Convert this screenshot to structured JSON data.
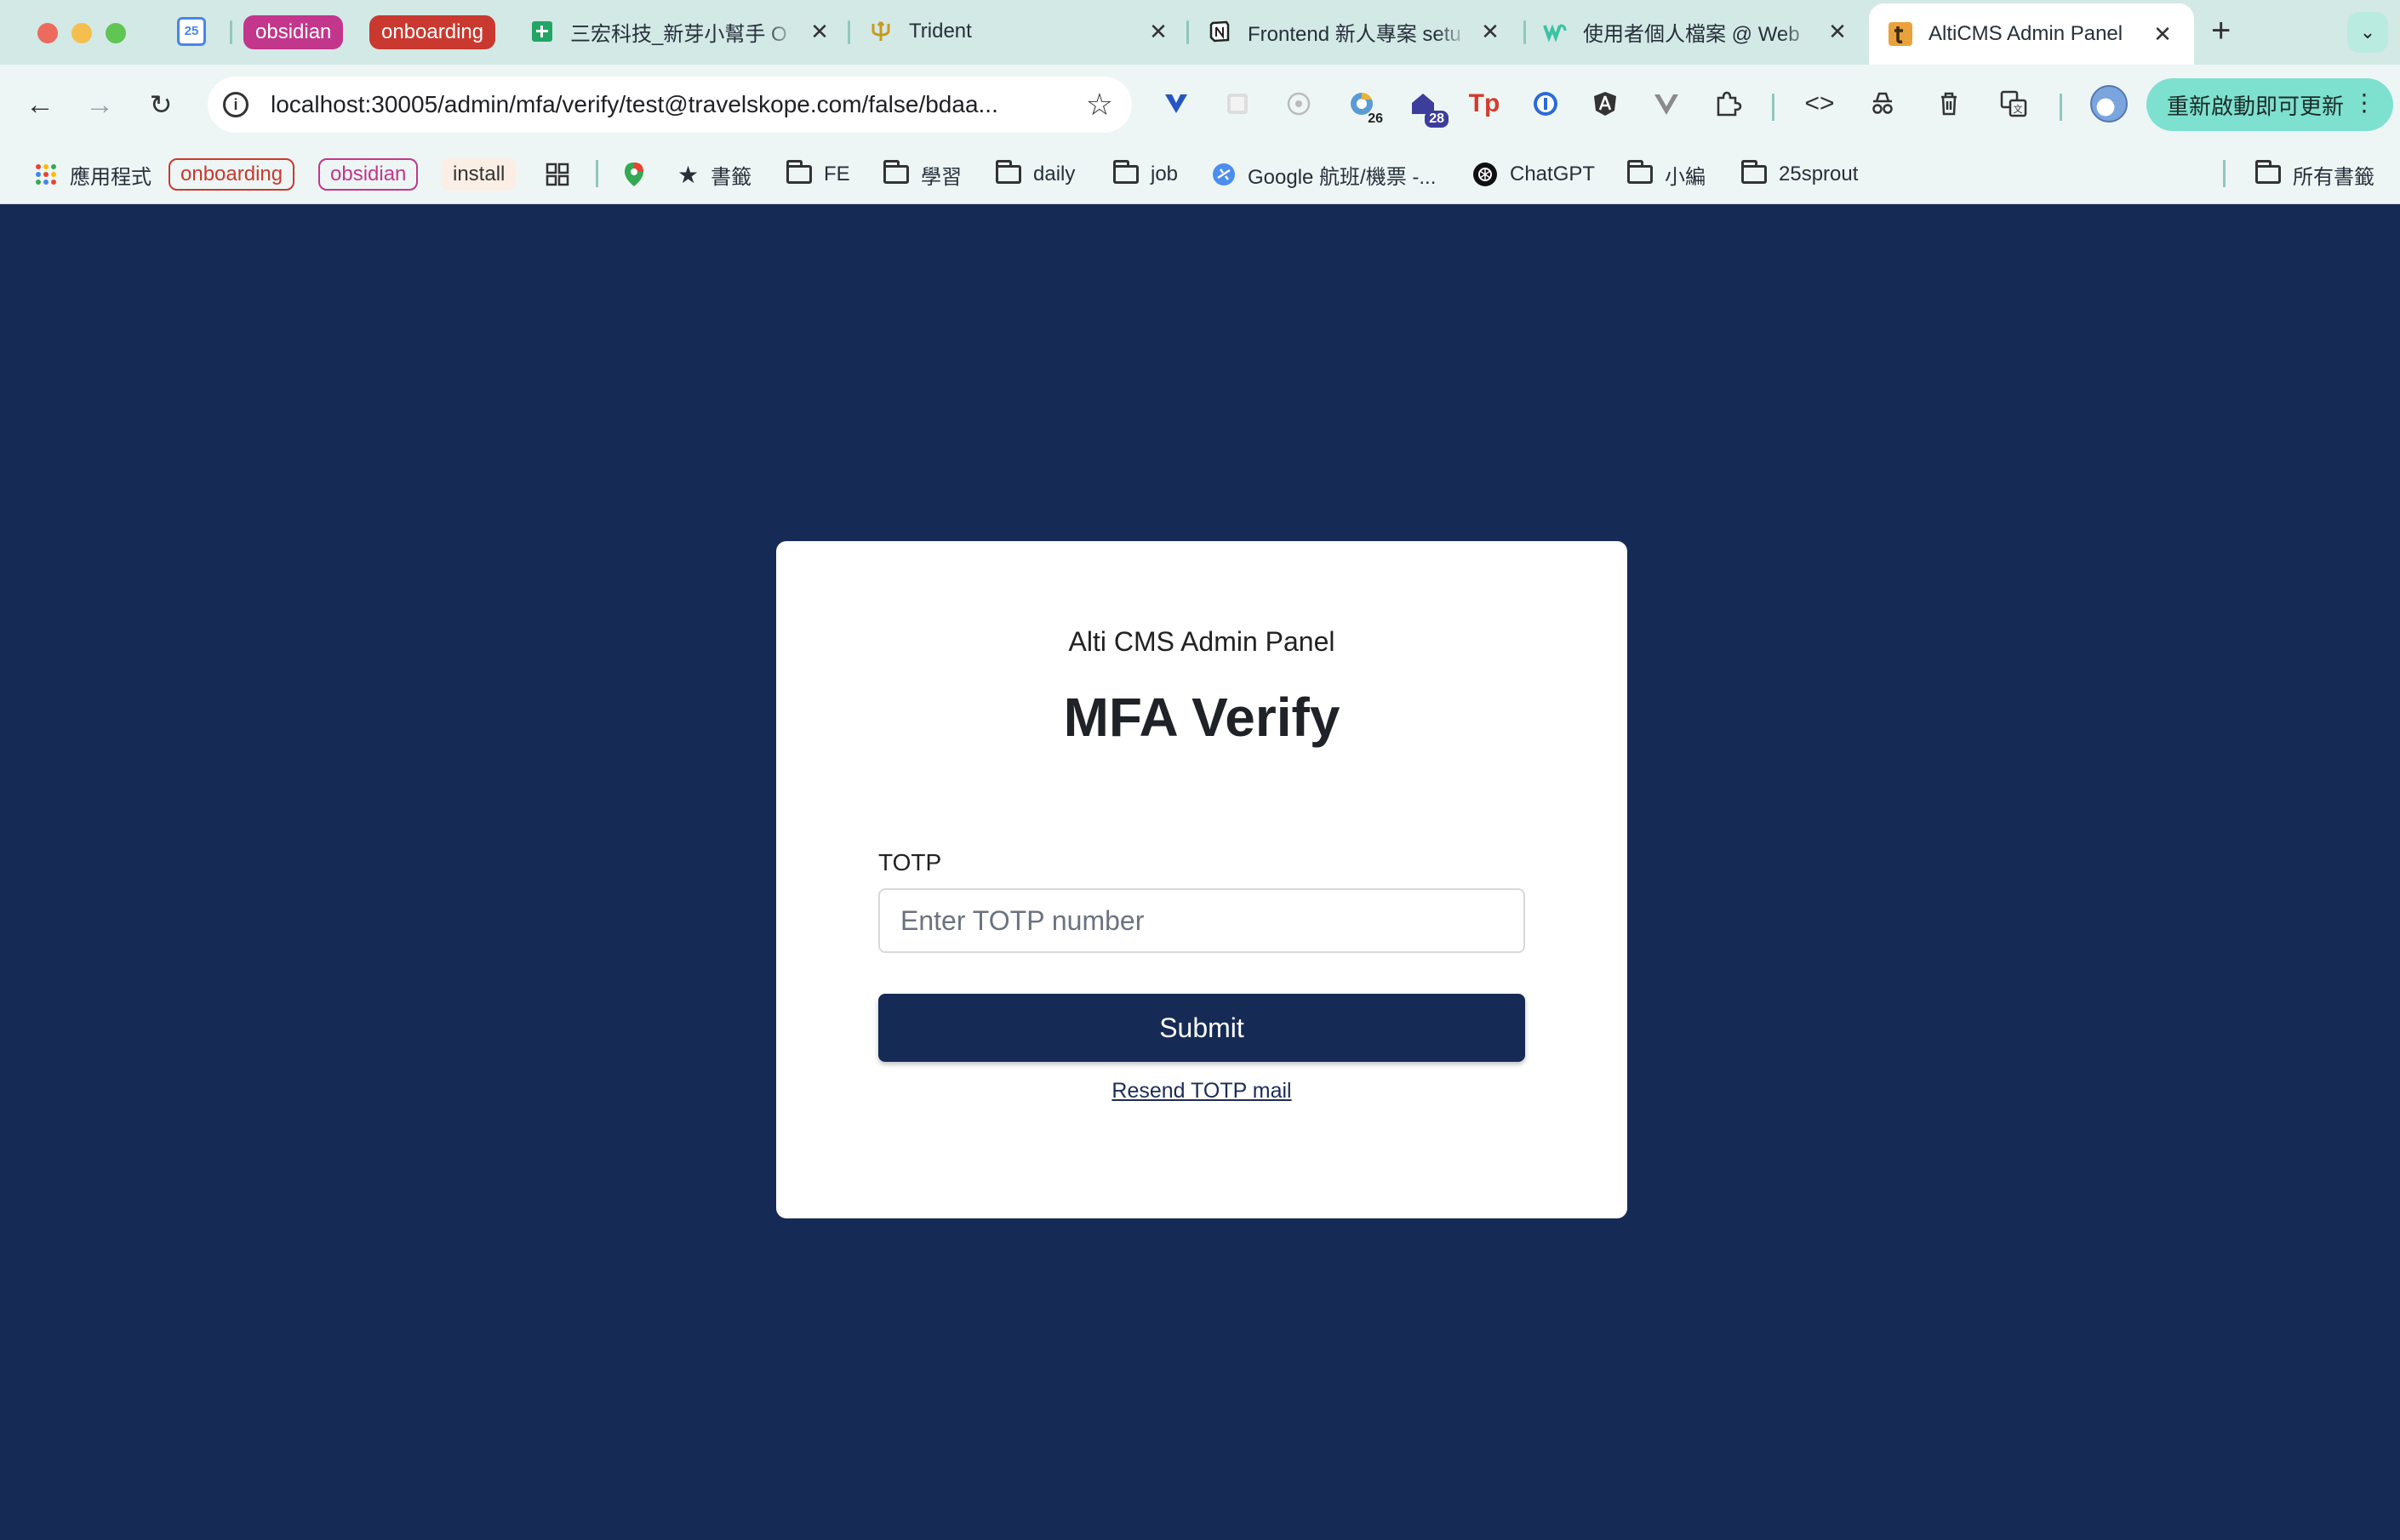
{
  "tabs": {
    "calendar_badge": "25",
    "groups": [
      {
        "label": "obsidian",
        "color": "#c2368c"
      },
      {
        "label": "onboarding",
        "color": "#c9392f"
      }
    ],
    "items": [
      {
        "title": "三宏科技_新芽小幫手 O",
        "icon": "sheets-icon"
      },
      {
        "title": "Trident",
        "icon": "trident-icon"
      },
      {
        "title": "Frontend 新人專案 setu",
        "icon": "notion-icon"
      },
      {
        "title": "使用者個人檔案 @ Web",
        "icon": "webflow-icon"
      },
      {
        "title": "AltiCMS Admin Panel",
        "icon": "alticms-icon",
        "active": true
      }
    ]
  },
  "toolbar": {
    "url": "localhost:30005/admin/mfa/verify/test@travelskope.com/false/bdaa...",
    "ext_badges": [
      "26",
      "28"
    ],
    "update_label": "重新啟動即可更新"
  },
  "bookmarks": {
    "apps": "應用程式",
    "chip_onboarding": "onboarding",
    "chip_obsidian": "obsidian",
    "chip_install": "install",
    "shugian": "書籤",
    "fe": "FE",
    "xuexi": "學習",
    "daily": "daily",
    "job": "job",
    "google_flights": "Google 航班/機票 -...",
    "chatgpt": "ChatGPT",
    "xiaobian": "小編",
    "sprout": "25sprout",
    "all_bookmarks": "所有書籤"
  },
  "card": {
    "app_name": "Alti CMS Admin Panel",
    "heading": "MFA Verify",
    "field_label": "TOTP",
    "input_placeholder": "Enter TOTP number",
    "submit_label": "Submit",
    "resend_label": "Resend TOTP mail"
  },
  "colors": {
    "page_bg": "#152a55",
    "button_bg": "#152a55",
    "card_bg": "#ffffff",
    "tabbar_bg": "#d3e9e6",
    "update_btn": "#7ee0cf"
  }
}
